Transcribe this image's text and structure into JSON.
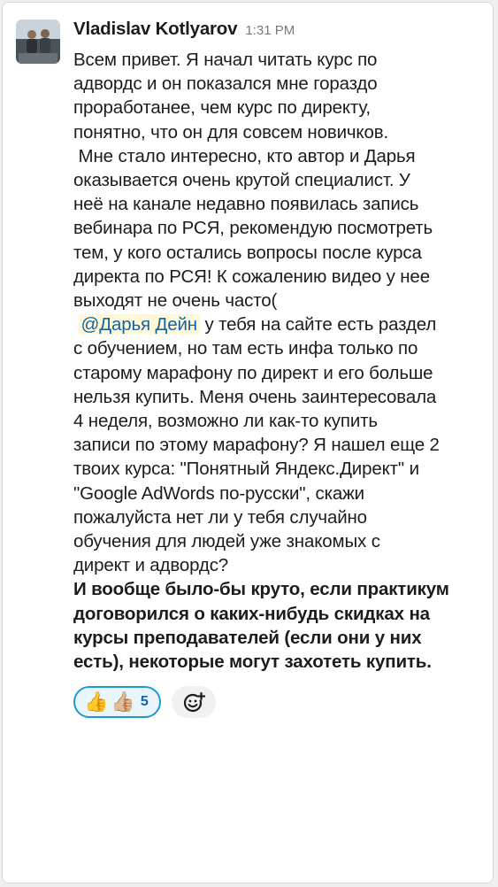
{
  "message": {
    "author": "Vladislav Kotlyarov",
    "time": "1:31 PM",
    "lines": [
      "Всем привет. Я начал читать курс по",
      "адвордс и он показался мне гораздо",
      "проработанее, чем курс по директу,",
      "понятно, что он для совсем новичков.",
      " Мне стало интересно, кто автор и Дарья",
      "оказывается очень крутой специалист. У",
      "неё на канале недавно появилась запись",
      "вебинара по РСЯ, рекомендую посмотреть",
      "тем, у кого остались вопросы после курса",
      "директа по РСЯ! К сожалению видео у нее",
      "выходят не очень часто("
    ],
    "mention_prefix": " ",
    "mention": "@Дарья Дейн",
    "mention_rest": " у тебя на сайте есть раздел",
    "lines2": [
      "с обучением, но там есть инфа только по",
      "старому марафону по директ и его больше",
      "нельзя купить. Меня очень заинтересовала",
      "4 неделя, возможно ли как-то купить",
      "записи по этому марафону? Я нашел еще 2",
      "твоих курса: \"Понятный Яндекс.Директ\" и",
      "\"Google AdWords по-русски\", скажи",
      "пожалуйста нет ли у тебя случайно",
      "обучения для людей уже знакомых с",
      "директ и адвордс?"
    ],
    "bold_lines": [
      "И вообще было-бы круто, если практикум",
      "договорился о каких-нибудь скидках на",
      "курсы преподавателей (если они у них",
      "есть), некоторые могут захотеть купить."
    ]
  },
  "reactions": {
    "emoji_1": "👍",
    "emoji_2": "👍🏼",
    "count": "5"
  },
  "icons": {
    "avatar": "user-avatar-photo",
    "add_reaction": "add-reaction-icon"
  }
}
